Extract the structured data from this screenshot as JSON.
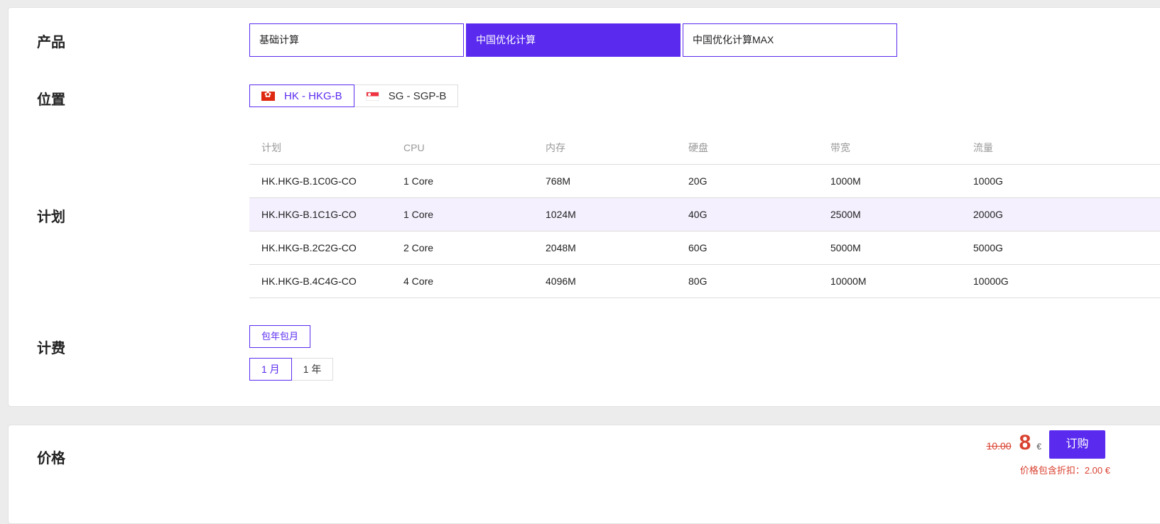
{
  "labels": {
    "product": "产品",
    "location": "位置",
    "plan": "计划",
    "billing": "计费",
    "price": "价格"
  },
  "products": [
    {
      "label": "基础计算",
      "active": false
    },
    {
      "label": "中国优化计算",
      "active": true
    },
    {
      "label": "中国优化计算MAX",
      "active": false
    }
  ],
  "locations": [
    {
      "label": "HK - HKG-B",
      "flag": "hong-kong-flag",
      "active": true
    },
    {
      "label": "SG - SGP-B",
      "flag": "singapore-flag",
      "active": false
    }
  ],
  "plan_table": {
    "headers": [
      "计划",
      "CPU",
      "内存",
      "硬盘",
      "带宽",
      "流量"
    ],
    "rows": [
      [
        "HK.HKG-B.1C0G-CO",
        "1 Core",
        "768M",
        "20G",
        "1000M",
        "1000G"
      ],
      [
        "HK.HKG-B.1C1G-CO",
        "1 Core",
        "1024M",
        "40G",
        "2500M",
        "2000G"
      ],
      [
        "HK.HKG-B.2C2G-CO",
        "2 Core",
        "2048M",
        "60G",
        "5000M",
        "5000G"
      ],
      [
        "HK.HKG-B.4C4G-CO",
        "4 Core",
        "4096M",
        "80G",
        "10000M",
        "10000G"
      ]
    ],
    "selected_index": 1
  },
  "billing": {
    "type_label": "包年包月",
    "periods": [
      {
        "label": "1 月",
        "active": true
      },
      {
        "label": "1 年",
        "active": false
      }
    ]
  },
  "price": {
    "old": "10.00",
    "new": "8",
    "currency": "€",
    "order_label": "订购",
    "discount_text": "价格包含折扣：2.00 €"
  },
  "colors": {
    "accent": "#5a2bef",
    "price_red": "#d9412f",
    "selected_row": "#f4f0fe"
  }
}
